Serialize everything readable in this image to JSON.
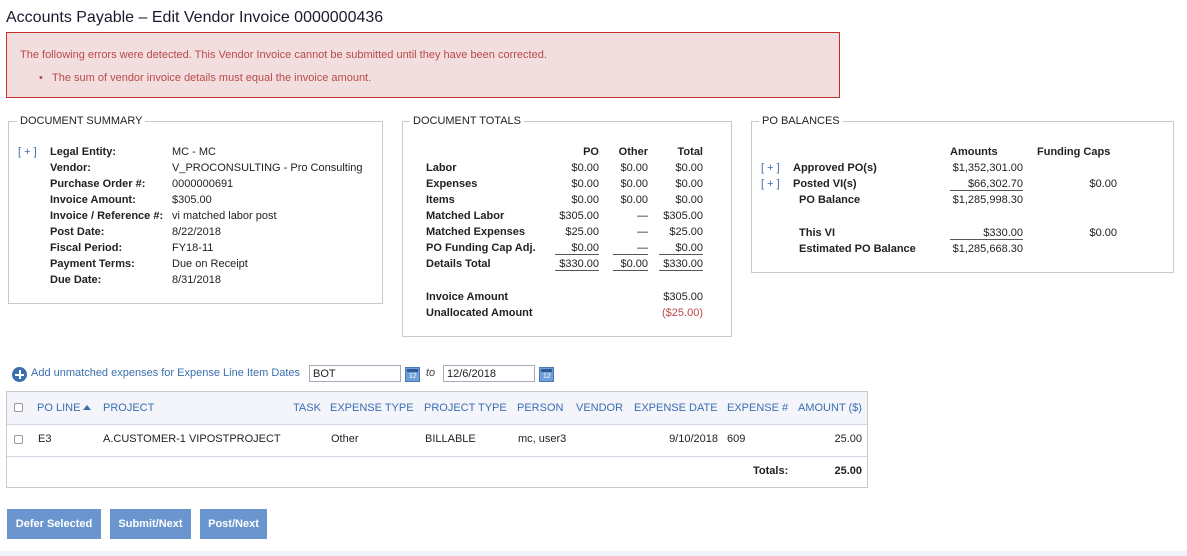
{
  "page": {
    "title": "Accounts Payable – Edit Vendor Invoice 0000000436"
  },
  "errors": {
    "message": "The following errors were detected. This Vendor Invoice cannot be submitted until they have been corrected.",
    "items": [
      "The sum of vendor invoice details must equal the invoice amount."
    ]
  },
  "document_summary": {
    "legend": "DOCUMENT SUMMARY",
    "expand": "[ + ]",
    "rows": [
      {
        "label": "Legal Entity:",
        "value": "MC - MC"
      },
      {
        "label": "Vendor:",
        "value": "V_PROCONSULTING - Pro Consulting"
      },
      {
        "label": "Purchase Order #:",
        "value": "0000000691"
      },
      {
        "label": "Invoice Amount:",
        "value": "$305.00"
      },
      {
        "label": "Invoice / Reference #:",
        "value": "vi matched labor post"
      },
      {
        "label": "Post Date:",
        "value": "8/22/2018"
      },
      {
        "label": "Fiscal Period:",
        "value": "FY18-11"
      },
      {
        "label": "Payment Terms:",
        "value": "Due on Receipt"
      },
      {
        "label": "Due Date:",
        "value": "8/31/2018"
      }
    ]
  },
  "document_totals": {
    "legend": "DOCUMENT TOTALS",
    "columns": [
      "PO",
      "Other",
      "Total"
    ],
    "rows": [
      {
        "label": "Labor",
        "po": "$0.00",
        "other": "$0.00",
        "total": "$0.00"
      },
      {
        "label": "Expenses",
        "po": "$0.00",
        "other": "$0.00",
        "total": "$0.00"
      },
      {
        "label": "Items",
        "po": "$0.00",
        "other": "$0.00",
        "total": "$0.00"
      },
      {
        "label": "Matched Labor",
        "po": "$305.00",
        "other": "—",
        "total": "$305.00"
      },
      {
        "label": "Matched Expenses",
        "po": "$25.00",
        "other": "—",
        "total": "$25.00"
      },
      {
        "label": "PO Funding Cap Adj.",
        "po": "$0.00",
        "other": "—",
        "total": "$0.00"
      },
      {
        "label": "Details Total",
        "po": "$330.00",
        "other": "$0.00",
        "total": "$330.00"
      }
    ],
    "invoice_amount_label": "Invoice Amount",
    "invoice_amount": "$305.00",
    "unallocated_label": "Unallocated Amount",
    "unallocated": "($25.00)"
  },
  "po_balances": {
    "legend": "PO BALANCES",
    "columns": [
      "Amounts",
      "Funding Caps"
    ],
    "expand": "[ + ]",
    "approved_label": "Approved PO(s)",
    "approved_amount": "$1,352,301.00",
    "posted_label": "Posted VI(s)",
    "posted_amount": "$66,302.70",
    "posted_cap": "$0.00",
    "po_balance_label": "PO Balance",
    "po_balance": "$1,285,998.30",
    "this_vi_label": "This VI",
    "this_vi": "$330.00",
    "this_vi_cap": "$0.00",
    "est_label": "Estimated PO Balance",
    "est_amount": "$1,285,668.30"
  },
  "filter": {
    "link": "Add unmatched expenses for Expense Line Item Dates",
    "from": "BOT",
    "to_label": "to",
    "to": "12/6/2018",
    "cal_glyph": "12"
  },
  "grid": {
    "headers": [
      "PO LINE",
      "PROJECT",
      "TASK",
      "EXPENSE TYPE",
      "PROJECT TYPE",
      "PERSON",
      "VENDOR",
      "EXPENSE DATE",
      "EXPENSE #",
      "AMOUNT ($)"
    ],
    "rows": [
      {
        "po_line": "E3",
        "project": "A.CUSTOMER-1 VIPOSTPROJECT",
        "task": "",
        "expense_type": "Other",
        "project_type": "BILLABLE",
        "person": "mc, user3",
        "vendor": "",
        "expense_date": "9/10/2018",
        "expense_no": "609",
        "amount": "25.00"
      }
    ],
    "totals_label": "Totals:",
    "totals_value": "25.00"
  },
  "buttons": {
    "defer": "Defer Selected",
    "submit": "Submit/Next",
    "post": "Post/Next"
  }
}
